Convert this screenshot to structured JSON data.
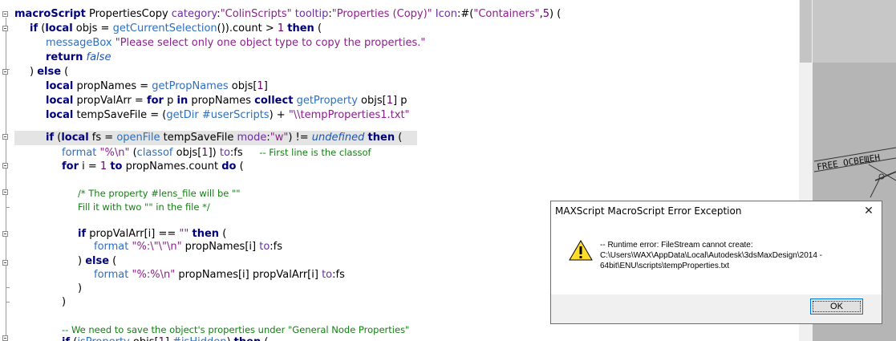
{
  "editor": {
    "lines": [
      [
        "macroScript PropertiesCopy category:\"ColinScripts\" tooltip:\"Properties (Copy)\" Icon:#(\"Containers\",5) ("
      ],
      [
        "if (local objs = getCurrentSelection()).count > 1 then ("
      ],
      [
        "messageBox \"Please select only one object type to copy the properties.\""
      ],
      [
        "return false"
      ],
      [
        ") else ("
      ],
      [
        "local propNames = getPropNames objs[1]"
      ],
      [
        "local propValArr = for p in propNames collect getProperty objs[1] p"
      ],
      [
        "local tempSaveFile = (getDir #userScripts) + \"\\\\tempProperties1.txt\""
      ],
      [
        ""
      ],
      [
        "if (local fs = openFile tempSaveFile mode:\"w\") != undefined then ("
      ],
      [
        "format \"%\\n\" (classof objs[1]) to:fs     -- First line is the classof"
      ],
      [
        "for i = 1 to propNames.count do ("
      ],
      [
        ""
      ],
      [
        "/* The property #lens_file will be \"\""
      ],
      [
        "Fill it with two \"\" in the file */"
      ],
      [
        ""
      ],
      [
        "if propValArr[i] == \"\" then ("
      ],
      [
        "format \"%:\\\"\\\"\\n\" propNames[i] to:fs"
      ],
      [
        ") else ("
      ],
      [
        "format \"%:%\\n\" propNames[i] propValArr[i] to:fs"
      ],
      [
        ")"
      ],
      [
        ")"
      ],
      [
        ""
      ],
      [
        "-- We need to save the object's properties under \"General Node Properties\""
      ],
      [
        "if (isProperty objs[1] #isHidden) then ("
      ]
    ]
  },
  "viewport": {
    "label": "FREE ОСВЕЩЕН"
  },
  "dialog": {
    "title": "MAXScript MacroScript Error Exception",
    "close_glyph": "✕",
    "message": "-- Runtime error: FileStream cannot create:\nC:\\Users\\WAX\\AppData\\Local\\Autodesk\\3dsMaxDesign\\2014 -\n64bit\\ENU\\scripts\\tempProperties.txt",
    "ok_label": "OK",
    "icon": "warning-icon"
  },
  "colors": {
    "keyword": "#00007a",
    "function": "#2b6fc0",
    "string": "#8b1f8b",
    "comment": "#128012",
    "dialog_button_border": "#0078d7"
  }
}
